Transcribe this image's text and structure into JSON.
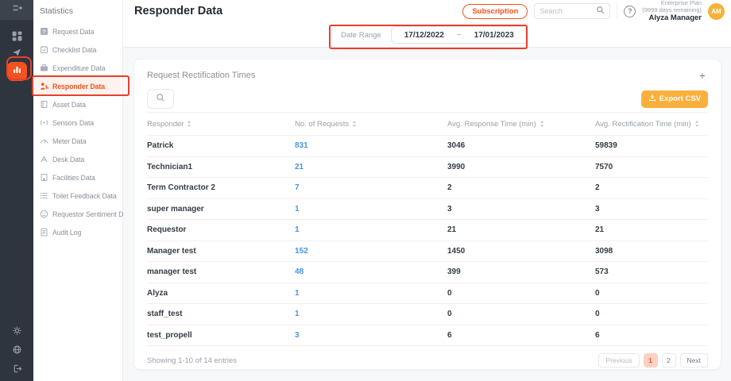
{
  "brand": {
    "accent_orange": "#f4511e",
    "amber": "#fbb03d",
    "link_blue": "#4596ea",
    "annotation_red": "#e8402d"
  },
  "sidebar": {
    "title": "Statistics",
    "items": [
      {
        "label": "Request Data",
        "icon": "request-icon",
        "active": false
      },
      {
        "label": "Checklist Data",
        "icon": "checklist-icon",
        "active": false
      },
      {
        "label": "Expenditure Data",
        "icon": "expenditure-icon",
        "active": false
      },
      {
        "label": "Responder Data",
        "icon": "responder-icon",
        "active": true
      },
      {
        "label": "Asset Data",
        "icon": "asset-icon",
        "active": false
      },
      {
        "label": "Sensors Data",
        "icon": "sensors-icon",
        "active": false
      },
      {
        "label": "Meter Data",
        "icon": "meter-icon",
        "active": false
      },
      {
        "label": "Desk Data",
        "icon": "desk-icon",
        "active": false
      },
      {
        "label": "Facilities Data",
        "icon": "facilities-icon",
        "active": false
      },
      {
        "label": "Toilet Feedback Data",
        "icon": "toilet-feedback-icon",
        "active": false
      },
      {
        "label": "Requestor Sentiment Data",
        "icon": "sentiment-icon",
        "active": false
      },
      {
        "label": "Audit Log",
        "icon": "audit-icon",
        "active": false
      }
    ]
  },
  "header": {
    "title": "Responder Data",
    "subscription_label": "Subscription",
    "search_placeholder": "Search",
    "plan_line1": "Enterprise Plan",
    "plan_line2": "(9999 days remaining)",
    "user_name": "Alyza Manager",
    "avatar_initials": "AM"
  },
  "filter_bar": {
    "date_range_label": "Date Range",
    "date_start": "17/12/2022",
    "date_separator": "~",
    "date_end": "17/01/2023"
  },
  "card": {
    "title": "Request Rectification Times",
    "add_button": "+",
    "export_label": "Export CSV",
    "table": {
      "columns": [
        "Responder",
        "No. of Requests",
        "Avg. Response Time (min)",
        "Avg. Rectification Time (min)"
      ],
      "rows": [
        {
          "responder": "Patrick",
          "requests": "831",
          "avg_response": "3046",
          "avg_rectification": "59839"
        },
        {
          "responder": "Technician1",
          "requests": "21",
          "avg_response": "3990",
          "avg_rectification": "7570"
        },
        {
          "responder": "Term Contractor 2",
          "requests": "7",
          "avg_response": "2",
          "avg_rectification": "2"
        },
        {
          "responder": "super manager",
          "requests": "1",
          "avg_response": "3",
          "avg_rectification": "3"
        },
        {
          "responder": "Requestor",
          "requests": "1",
          "avg_response": "21",
          "avg_rectification": "21"
        },
        {
          "responder": "Manager test",
          "requests": "152",
          "avg_response": "1450",
          "avg_rectification": "3098"
        },
        {
          "responder": "manager test",
          "requests": "48",
          "avg_response": "399",
          "avg_rectification": "573"
        },
        {
          "responder": "Alyza",
          "requests": "1",
          "avg_response": "0",
          "avg_rectification": "0"
        },
        {
          "responder": "staff_test",
          "requests": "1",
          "avg_response": "0",
          "avg_rectification": "0"
        },
        {
          "responder": "test_propell",
          "requests": "3",
          "avg_response": "6",
          "avg_rectification": "6"
        }
      ]
    },
    "footer": {
      "showing": "Showing 1-10 of 14 entries",
      "previous": "Previous",
      "page1": "1",
      "page2": "2",
      "next": "Next"
    }
  }
}
